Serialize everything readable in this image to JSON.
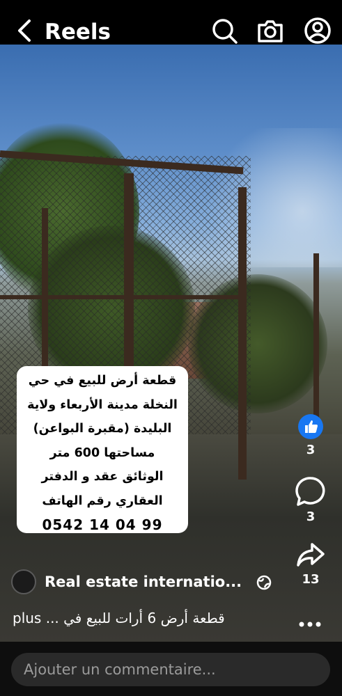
{
  "header": {
    "title": "Reels",
    "icons": [
      "back-arrow-icon",
      "search-icon",
      "camera-icon",
      "profile-icon"
    ]
  },
  "video": {
    "overlay_lines": [
      "قطعة أرض للبيع في حي",
      "النخلة مدينة الأربعاء ولاية",
      "البليدة (مقبرة البواعن)",
      "مساحتها 600 متر",
      "الوثائق عقد و الدفتر",
      "العقاري رقم الهاتف",
      "0542 14 04 99"
    ]
  },
  "actions": {
    "like_count": "3",
    "comment_count": "3",
    "share_count": "13",
    "like_color": "#1877f2"
  },
  "post": {
    "author": "Real estate internatio...",
    "description": "plus ... قطعة أرض 6 أرات للبيع في"
  },
  "comment": {
    "placeholder": "Ajouter un commentaire..."
  }
}
